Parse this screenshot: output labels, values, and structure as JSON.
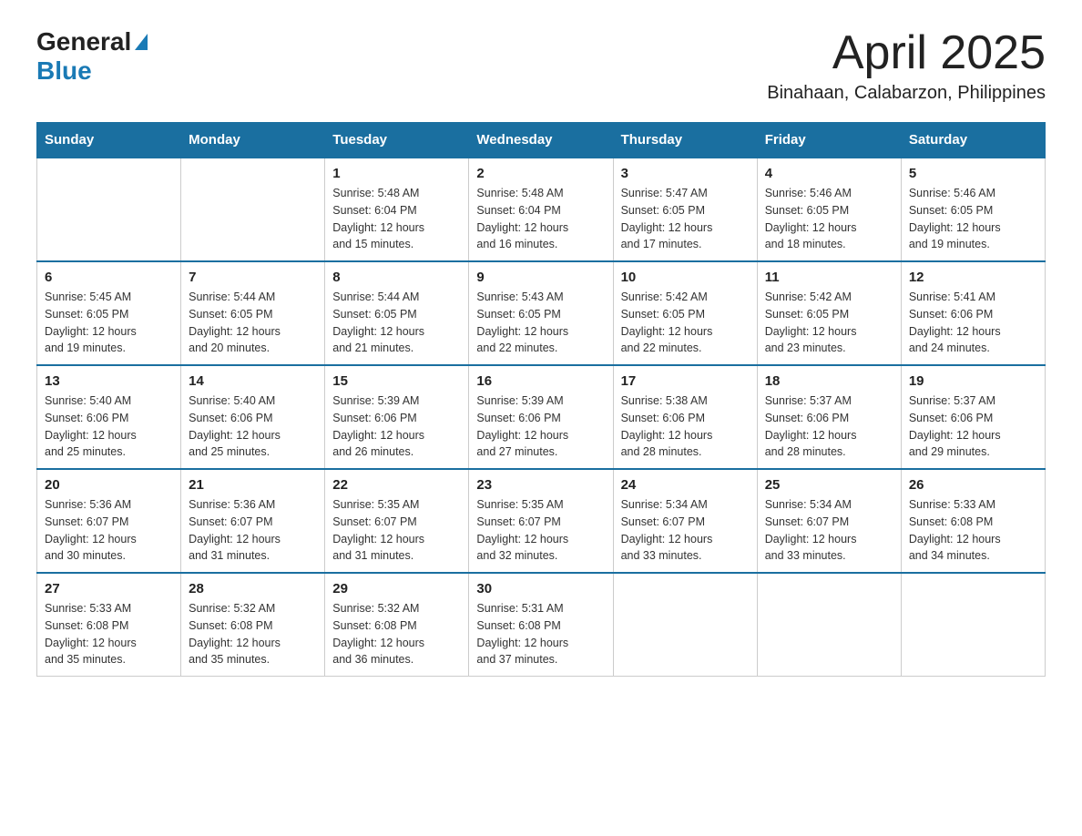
{
  "header": {
    "logo_general": "General",
    "logo_blue": "Blue",
    "month_title": "April 2025",
    "location": "Binahaan, Calabarzon, Philippines"
  },
  "weekdays": [
    "Sunday",
    "Monday",
    "Tuesday",
    "Wednesday",
    "Thursday",
    "Friday",
    "Saturday"
  ],
  "weeks": [
    [
      {
        "day": "",
        "info": ""
      },
      {
        "day": "",
        "info": ""
      },
      {
        "day": "1",
        "info": "Sunrise: 5:48 AM\nSunset: 6:04 PM\nDaylight: 12 hours\nand 15 minutes."
      },
      {
        "day": "2",
        "info": "Sunrise: 5:48 AM\nSunset: 6:04 PM\nDaylight: 12 hours\nand 16 minutes."
      },
      {
        "day": "3",
        "info": "Sunrise: 5:47 AM\nSunset: 6:05 PM\nDaylight: 12 hours\nand 17 minutes."
      },
      {
        "day": "4",
        "info": "Sunrise: 5:46 AM\nSunset: 6:05 PM\nDaylight: 12 hours\nand 18 minutes."
      },
      {
        "day": "5",
        "info": "Sunrise: 5:46 AM\nSunset: 6:05 PM\nDaylight: 12 hours\nand 19 minutes."
      }
    ],
    [
      {
        "day": "6",
        "info": "Sunrise: 5:45 AM\nSunset: 6:05 PM\nDaylight: 12 hours\nand 19 minutes."
      },
      {
        "day": "7",
        "info": "Sunrise: 5:44 AM\nSunset: 6:05 PM\nDaylight: 12 hours\nand 20 minutes."
      },
      {
        "day": "8",
        "info": "Sunrise: 5:44 AM\nSunset: 6:05 PM\nDaylight: 12 hours\nand 21 minutes."
      },
      {
        "day": "9",
        "info": "Sunrise: 5:43 AM\nSunset: 6:05 PM\nDaylight: 12 hours\nand 22 minutes."
      },
      {
        "day": "10",
        "info": "Sunrise: 5:42 AM\nSunset: 6:05 PM\nDaylight: 12 hours\nand 22 minutes."
      },
      {
        "day": "11",
        "info": "Sunrise: 5:42 AM\nSunset: 6:05 PM\nDaylight: 12 hours\nand 23 minutes."
      },
      {
        "day": "12",
        "info": "Sunrise: 5:41 AM\nSunset: 6:06 PM\nDaylight: 12 hours\nand 24 minutes."
      }
    ],
    [
      {
        "day": "13",
        "info": "Sunrise: 5:40 AM\nSunset: 6:06 PM\nDaylight: 12 hours\nand 25 minutes."
      },
      {
        "day": "14",
        "info": "Sunrise: 5:40 AM\nSunset: 6:06 PM\nDaylight: 12 hours\nand 25 minutes."
      },
      {
        "day": "15",
        "info": "Sunrise: 5:39 AM\nSunset: 6:06 PM\nDaylight: 12 hours\nand 26 minutes."
      },
      {
        "day": "16",
        "info": "Sunrise: 5:39 AM\nSunset: 6:06 PM\nDaylight: 12 hours\nand 27 minutes."
      },
      {
        "day": "17",
        "info": "Sunrise: 5:38 AM\nSunset: 6:06 PM\nDaylight: 12 hours\nand 28 minutes."
      },
      {
        "day": "18",
        "info": "Sunrise: 5:37 AM\nSunset: 6:06 PM\nDaylight: 12 hours\nand 28 minutes."
      },
      {
        "day": "19",
        "info": "Sunrise: 5:37 AM\nSunset: 6:06 PM\nDaylight: 12 hours\nand 29 minutes."
      }
    ],
    [
      {
        "day": "20",
        "info": "Sunrise: 5:36 AM\nSunset: 6:07 PM\nDaylight: 12 hours\nand 30 minutes."
      },
      {
        "day": "21",
        "info": "Sunrise: 5:36 AM\nSunset: 6:07 PM\nDaylight: 12 hours\nand 31 minutes."
      },
      {
        "day": "22",
        "info": "Sunrise: 5:35 AM\nSunset: 6:07 PM\nDaylight: 12 hours\nand 31 minutes."
      },
      {
        "day": "23",
        "info": "Sunrise: 5:35 AM\nSunset: 6:07 PM\nDaylight: 12 hours\nand 32 minutes."
      },
      {
        "day": "24",
        "info": "Sunrise: 5:34 AM\nSunset: 6:07 PM\nDaylight: 12 hours\nand 33 minutes."
      },
      {
        "day": "25",
        "info": "Sunrise: 5:34 AM\nSunset: 6:07 PM\nDaylight: 12 hours\nand 33 minutes."
      },
      {
        "day": "26",
        "info": "Sunrise: 5:33 AM\nSunset: 6:08 PM\nDaylight: 12 hours\nand 34 minutes."
      }
    ],
    [
      {
        "day": "27",
        "info": "Sunrise: 5:33 AM\nSunset: 6:08 PM\nDaylight: 12 hours\nand 35 minutes."
      },
      {
        "day": "28",
        "info": "Sunrise: 5:32 AM\nSunset: 6:08 PM\nDaylight: 12 hours\nand 35 minutes."
      },
      {
        "day": "29",
        "info": "Sunrise: 5:32 AM\nSunset: 6:08 PM\nDaylight: 12 hours\nand 36 minutes."
      },
      {
        "day": "30",
        "info": "Sunrise: 5:31 AM\nSunset: 6:08 PM\nDaylight: 12 hours\nand 37 minutes."
      },
      {
        "day": "",
        "info": ""
      },
      {
        "day": "",
        "info": ""
      },
      {
        "day": "",
        "info": ""
      }
    ]
  ]
}
